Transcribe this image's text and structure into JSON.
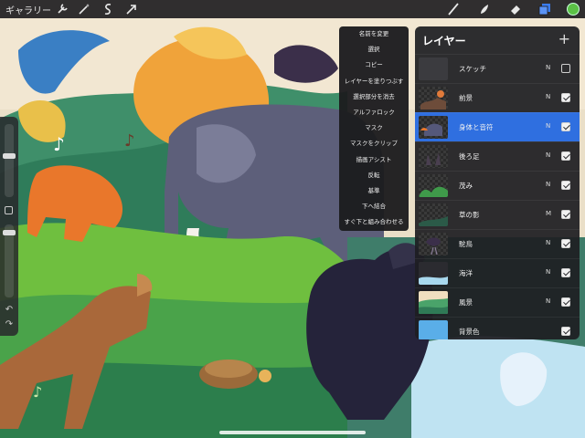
{
  "toolbar": {
    "gallery_label": "ギャラリー",
    "left_tools": [
      "wrench-icon",
      "magic-wand-icon",
      "selection-icon",
      "transform-arrow-icon"
    ],
    "right_tools": [
      "brush-icon",
      "smudge-icon",
      "eraser-icon",
      "layers-icon"
    ],
    "active_color": "#5bc146"
  },
  "menu": {
    "items": [
      "名前を変更",
      "選択",
      "コピー",
      "レイヤーを塗りつぶす",
      "選択部分を消去",
      "アルファロック",
      "マスク",
      "マスクをクリップ",
      "描画アシスト",
      "反転",
      "基準",
      "下へ結合",
      "すぐ下と組み合わせる"
    ]
  },
  "layers": {
    "title": "レイヤー",
    "add_symbol": "+",
    "items": [
      {
        "name": "スケッチ",
        "blend": "N",
        "visible": false,
        "selected": false
      },
      {
        "name": "前景",
        "blend": "N",
        "visible": true,
        "selected": false
      },
      {
        "name": "身体と音符",
        "blend": "N",
        "visible": true,
        "selected": true
      },
      {
        "name": "後ろ足",
        "blend": "N",
        "visible": true,
        "selected": false
      },
      {
        "name": "茂み",
        "blend": "N",
        "visible": true,
        "selected": false
      },
      {
        "name": "草の影",
        "blend": "M",
        "visible": true,
        "selected": false
      },
      {
        "name": "駝鳥",
        "blend": "N",
        "visible": true,
        "selected": false
      },
      {
        "name": "海洋",
        "blend": "N",
        "visible": true,
        "selected": false
      },
      {
        "name": "風景",
        "blend": "N",
        "visible": true,
        "selected": false
      },
      {
        "name": "背景色",
        "blend": "",
        "visible": true,
        "selected": false
      }
    ]
  },
  "colors": {
    "selected_row": "#2f6fe0",
    "background_swatch": "#5aaee8"
  }
}
